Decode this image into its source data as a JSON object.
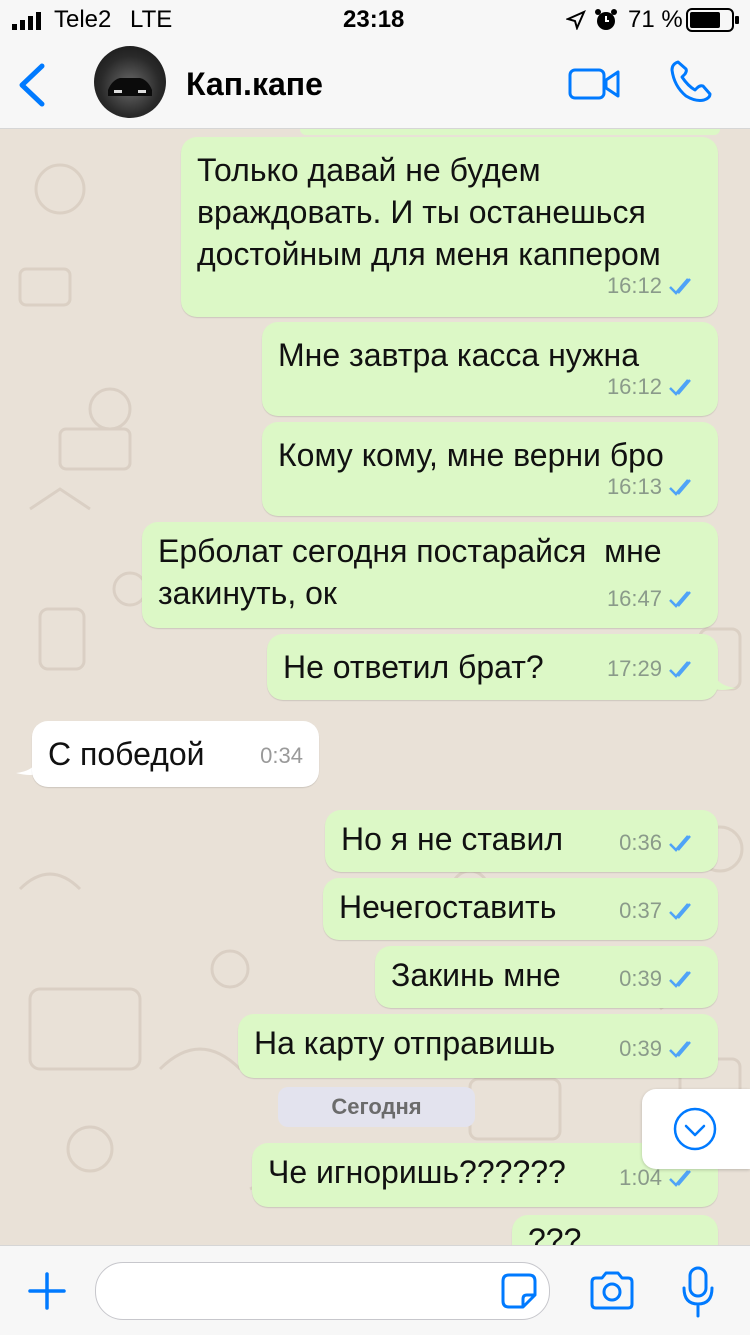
{
  "status_bar": {
    "carrier": "Tele2",
    "network": "LTE",
    "time": "23:18",
    "battery": "71 %"
  },
  "header": {
    "contact_name": "Кап.капе",
    "icons": [
      "back-chevron-icon",
      "video-call-icon",
      "phone-call-icon"
    ]
  },
  "messages": [
    {
      "dir": "out",
      "text": "Только давай не будем\nвраждовать. И ты останешься\nдостойным для меня каппером",
      "time": "16:12"
    },
    {
      "dir": "out",
      "text": "Мне завтра касса нужна",
      "time": "16:12"
    },
    {
      "dir": "out",
      "text": "Кому кому, мне верни бро",
      "time": "16:13"
    },
    {
      "dir": "out",
      "text": "Ерболат сегодня постарайся  мне\nзакинуть, ок",
      "time": "16:47"
    },
    {
      "dir": "out",
      "text": "Не ответил брат?",
      "time": "17:29"
    },
    {
      "dir": "in",
      "text": "С победой",
      "time": "0:34"
    },
    {
      "dir": "out",
      "text": "Но я не ставил",
      "time": "0:36"
    },
    {
      "dir": "out",
      "text": "Нечегоставить",
      "time": "0:37"
    },
    {
      "dir": "out",
      "text": "Закинь мне",
      "time": "0:39"
    },
    {
      "dir": "out",
      "text": "На карту отправишь",
      "time": "0:39"
    },
    {
      "dir": "out",
      "text": "Че игноришь??????",
      "time": "1:04"
    },
    {
      "dir": "out",
      "text": "???",
      "time": ""
    }
  ],
  "date_divider": "Сегодня",
  "colors": {
    "accent": "#007aff",
    "outgoing_bubble": "#dcf8c6",
    "incoming_bubble": "#ffffff",
    "read_ticks": "#4fa3f7"
  }
}
